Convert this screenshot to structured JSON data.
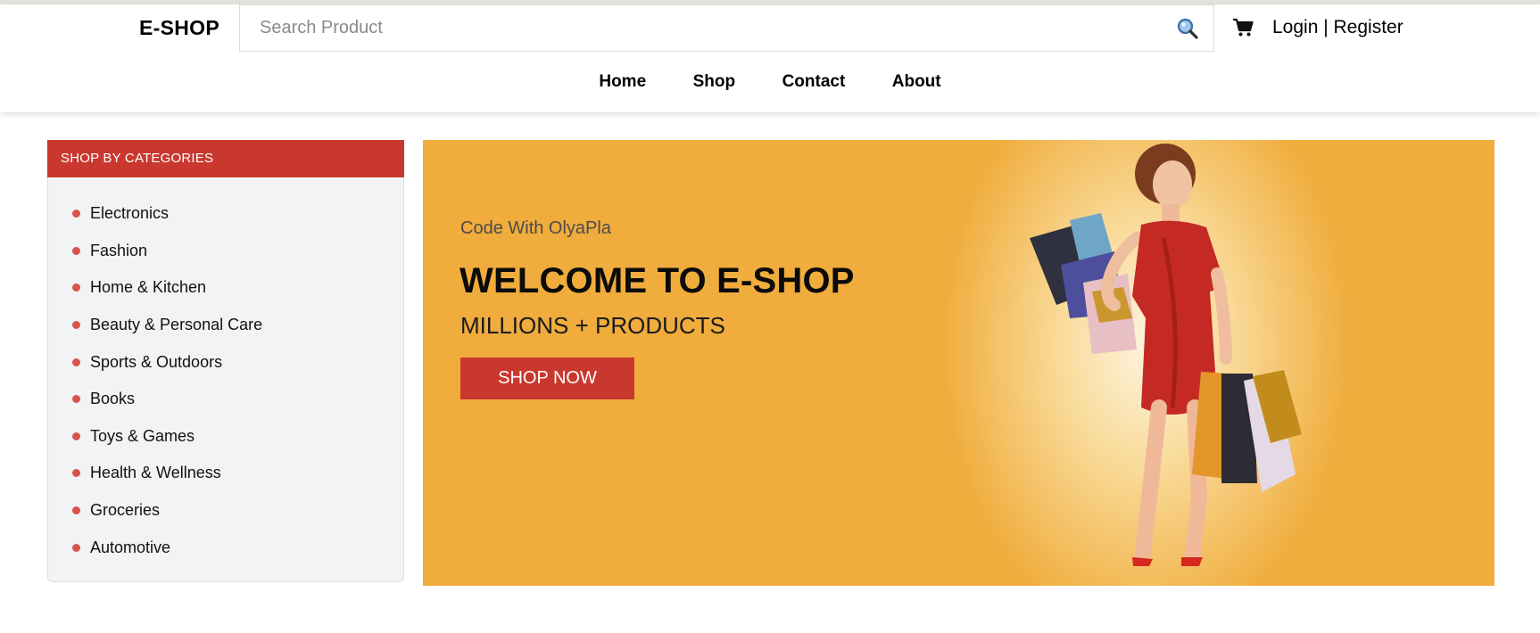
{
  "header": {
    "logo": "E-SHOP",
    "search_placeholder": "Search Product",
    "search_icon": "magnifier-icon",
    "cart_icon": "cart-icon",
    "login_label": "Login",
    "separator": " | ",
    "register_label": "Register"
  },
  "nav": {
    "items": [
      "Home",
      "Shop",
      "Contact",
      "About"
    ]
  },
  "sidebar": {
    "title": "SHOP BY CATEGORIES",
    "categories": [
      "Electronics",
      "Fashion",
      "Home & Kitchen",
      "Beauty & Personal Care",
      "Sports & Outdoors",
      "Books",
      "Toys & Games",
      "Health & Wellness",
      "Groceries",
      "Automotive"
    ]
  },
  "banner": {
    "tagline": "Code With OlyaPla",
    "title": "WELCOME TO E-SHOP",
    "subtitle": "MILLIONS + PRODUCTS",
    "cta_label": "SHOP NOW"
  },
  "colors": {
    "accent": "#c9382f",
    "banner_bg": "#f0ac3c",
    "sidebar_bg": "#f2f3f5",
    "dot": "#d6544c"
  }
}
